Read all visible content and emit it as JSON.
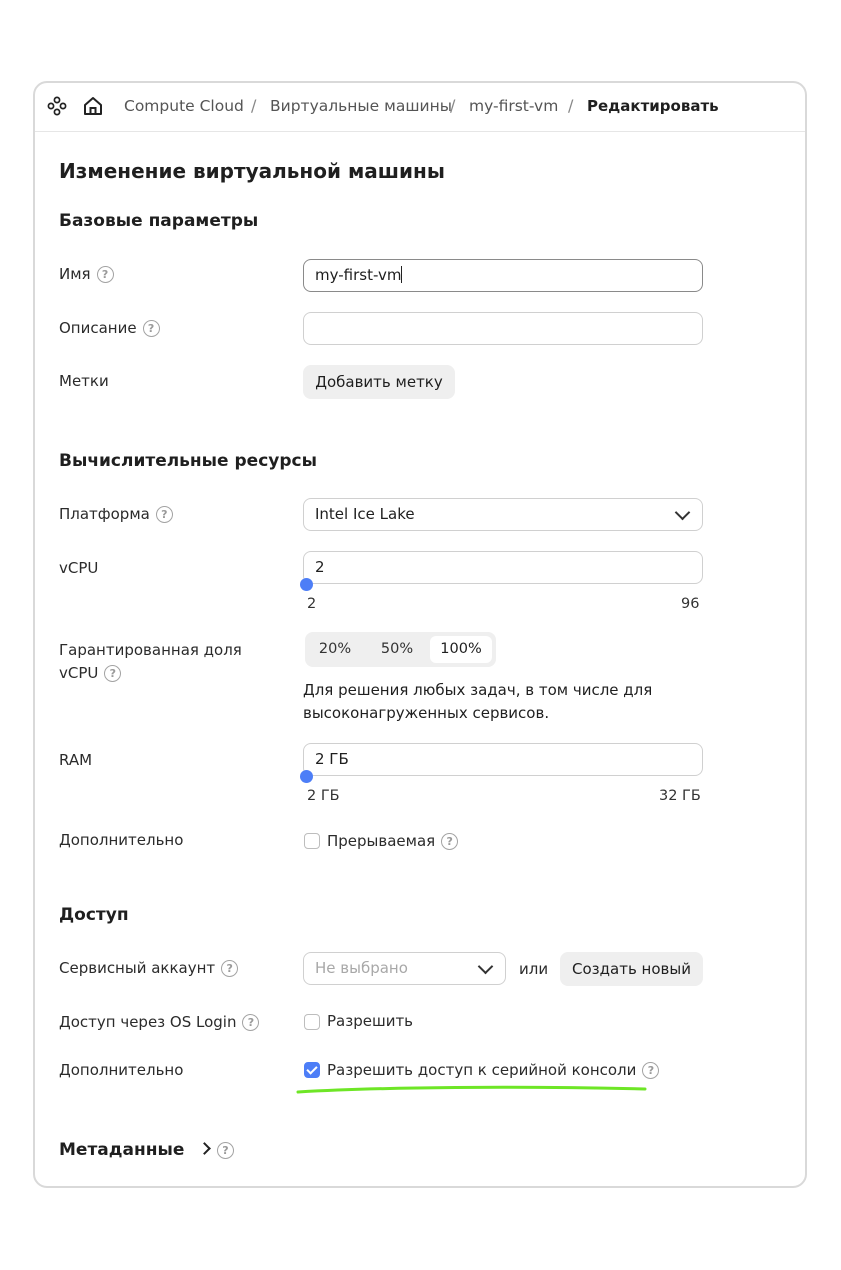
{
  "breadcrumbs": [
    "Compute Cloud",
    "Виртуальные машины",
    "my-first-vm"
  ],
  "breadcrumb_current": "Редактировать",
  "breadcrumb_sep": "/",
  "page_title": "Изменение виртуальной машины",
  "base": {
    "section_title": "Базовые параметры",
    "name_label": "Имя",
    "name_value": "my-first-vm",
    "description_label": "Описание",
    "description_value": "",
    "labels_label": "Метки",
    "add_label_button": "Добавить метку"
  },
  "compute": {
    "section_title": "Вычислительные ресурсы",
    "platform_label": "Платформа",
    "platform_value": "Intel Ice Lake",
    "vcpu_label": "vCPU",
    "vcpu_value": "2",
    "vcpu_min": "2",
    "vcpu_max": "96",
    "share_label_line1": "Гарантированная доля",
    "share_label_line2": "vCPU",
    "share_options": [
      "20%",
      "50%",
      "100%"
    ],
    "share_selected": "100%",
    "share_hint_line1": "Для решения любых задач, в том числе для",
    "share_hint_line2": "высоконагруженных сервисов.",
    "ram_label": "RAM",
    "ram_value": "2 ГБ",
    "ram_min": "2 ГБ",
    "ram_max": "32 ГБ",
    "extra_label": "Дополнительно",
    "preemptible_label": "Прерываемая",
    "preemptible_checked": false
  },
  "access": {
    "section_title": "Доступ",
    "service_account_label": "Сервисный аккаунт",
    "service_account_placeholder": "Не выбрано",
    "or_text": "или",
    "create_button": "Создать новый",
    "oslogin_label": "Доступ через OS Login",
    "oslogin_checkbox_label": "Разрешить",
    "oslogin_checked": false,
    "extra_label": "Дополнительно",
    "serial_console_label": "Разрешить доступ к серийной консоли",
    "serial_console_checked": true
  },
  "metadata": {
    "section_title": "Метаданные"
  },
  "colors": {
    "accent": "#4d7ef7",
    "highlight_underline": "#6ee626"
  }
}
